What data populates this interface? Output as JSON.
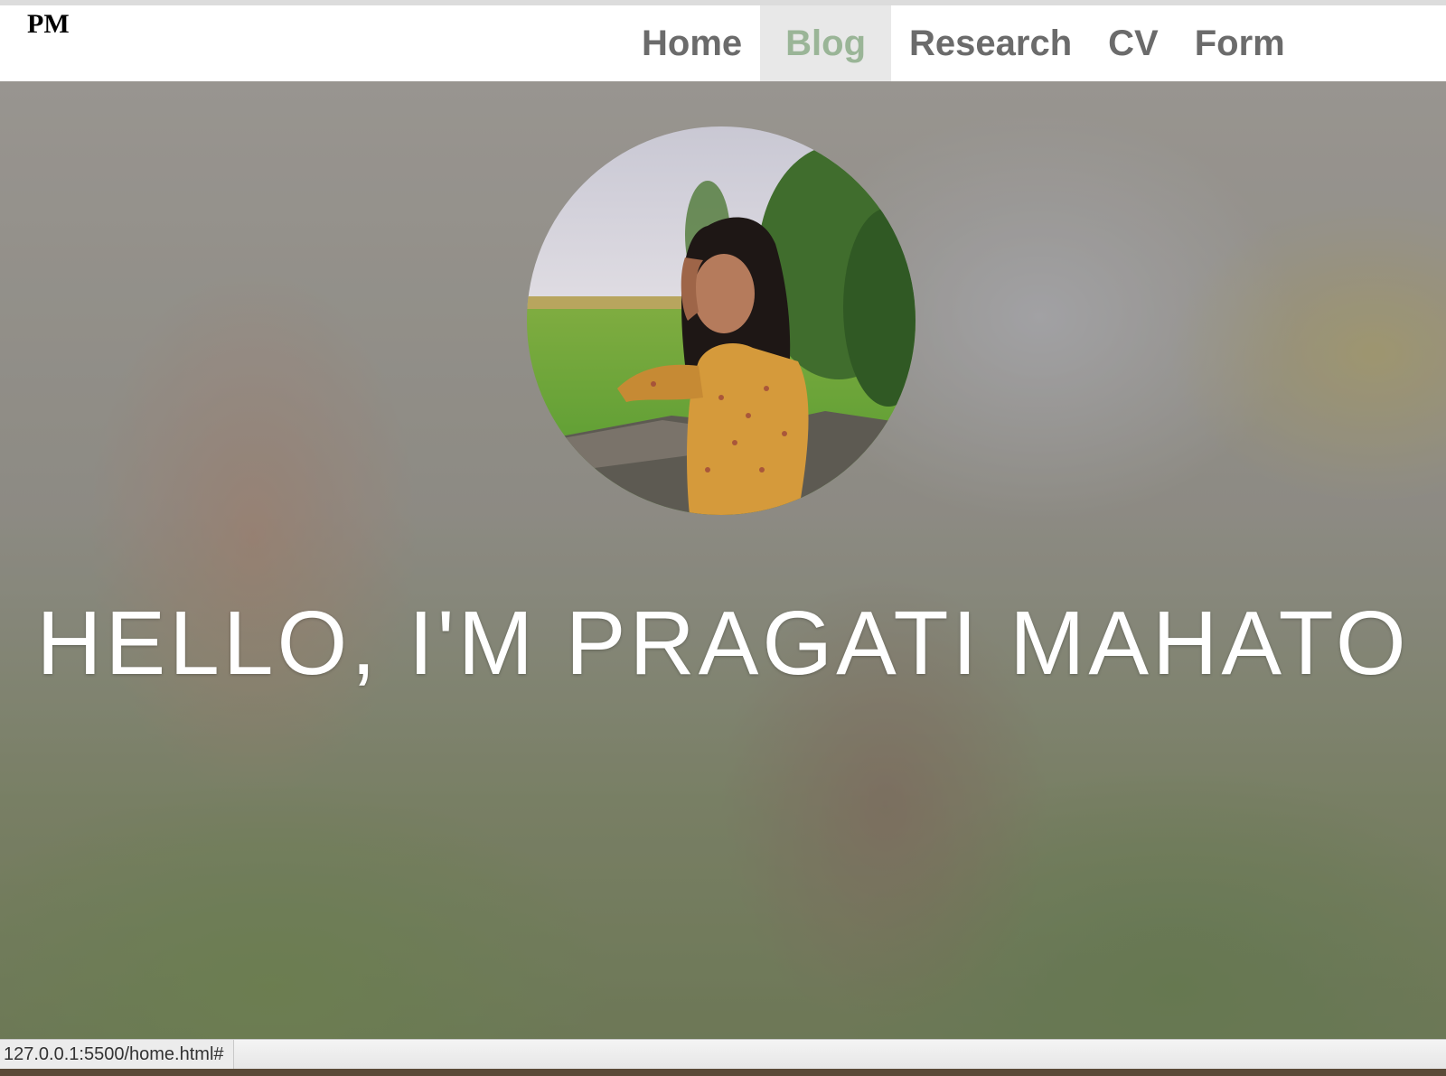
{
  "header": {
    "logo": "PM",
    "nav": [
      {
        "label": "Home",
        "active": false
      },
      {
        "label": "Blog",
        "active": true
      },
      {
        "label": "Research",
        "active": false
      },
      {
        "label": "CV",
        "active": false
      },
      {
        "label": "Form",
        "active": false
      }
    ],
    "active_color": "#9ab597",
    "link_color": "#6b6b6b"
  },
  "hero": {
    "headline": "HELLO, I'M PRAGATI MAHATO",
    "avatar_icon": "profile-photo"
  },
  "statusbar": {
    "url": "127.0.0.1:5500/home.html#"
  }
}
